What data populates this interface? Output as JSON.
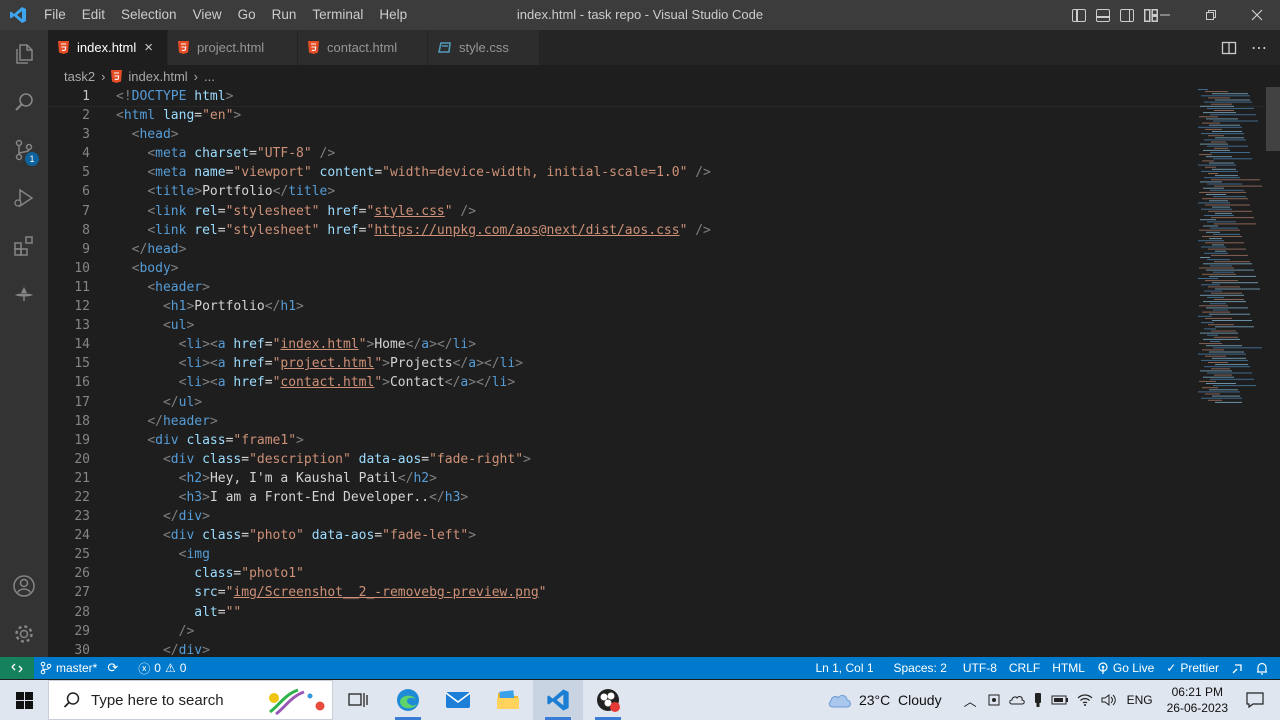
{
  "window": {
    "title": "index.html - task repo - Visual Studio Code"
  },
  "menu": [
    "File",
    "Edit",
    "Selection",
    "View",
    "Go",
    "Run",
    "Terminal",
    "Help"
  ],
  "tabs": [
    {
      "label": "index.html",
      "type": "html",
      "active": true
    },
    {
      "label": "project.html",
      "type": "html",
      "active": false
    },
    {
      "label": "contact.html",
      "type": "html",
      "active": false
    },
    {
      "label": "style.css",
      "type": "css",
      "active": false
    }
  ],
  "tab_close_glyph": "×",
  "breadcrumb": {
    "folder": "task2",
    "file": "index.html",
    "more": "..."
  },
  "activity_badge": "1",
  "editor": {
    "current_line": 1,
    "lines": [
      [
        [
          "br",
          "<!"
        ],
        [
          "tag",
          "DOCTYPE"
        ],
        [
          "txt",
          " "
        ],
        [
          "attr",
          "html"
        ],
        [
          "br",
          ">"
        ]
      ],
      [
        [
          "br",
          "<"
        ],
        [
          "tag",
          "html"
        ],
        [
          "txt",
          " "
        ],
        [
          "attr",
          "lang"
        ],
        [
          "txt",
          "="
        ],
        [
          "str",
          "\"en\""
        ],
        [
          "br",
          ">"
        ]
      ],
      [
        [
          "txt",
          "  "
        ],
        [
          "br",
          "<"
        ],
        [
          "tag",
          "head"
        ],
        [
          "br",
          ">"
        ]
      ],
      [
        [
          "txt",
          "    "
        ],
        [
          "br",
          "<"
        ],
        [
          "tag",
          "meta"
        ],
        [
          "txt",
          " "
        ],
        [
          "attr",
          "charset"
        ],
        [
          "txt",
          "="
        ],
        [
          "str",
          "\"UTF-8\""
        ],
        [
          "txt",
          " "
        ],
        [
          "br",
          "/>"
        ]
      ],
      [
        [
          "txt",
          "    "
        ],
        [
          "br",
          "<"
        ],
        [
          "tag",
          "meta"
        ],
        [
          "txt",
          " "
        ],
        [
          "attr",
          "name"
        ],
        [
          "txt",
          "="
        ],
        [
          "str",
          "\"viewport\""
        ],
        [
          "txt",
          " "
        ],
        [
          "attr",
          "content"
        ],
        [
          "txt",
          "="
        ],
        [
          "str",
          "\"width=device-width, initial-scale=1.0\""
        ],
        [
          "txt",
          " "
        ],
        [
          "br",
          "/>"
        ]
      ],
      [
        [
          "txt",
          "    "
        ],
        [
          "br",
          "<"
        ],
        [
          "tag",
          "title"
        ],
        [
          "br",
          ">"
        ],
        [
          "txt",
          "Portfolio"
        ],
        [
          "br",
          "</"
        ],
        [
          "tag",
          "title"
        ],
        [
          "br",
          ">"
        ]
      ],
      [
        [
          "txt",
          "    "
        ],
        [
          "br",
          "<"
        ],
        [
          "tag",
          "link"
        ],
        [
          "txt",
          " "
        ],
        [
          "attr",
          "rel"
        ],
        [
          "txt",
          "="
        ],
        [
          "str",
          "\"stylesheet\""
        ],
        [
          "txt",
          " "
        ],
        [
          "attr",
          "href"
        ],
        [
          "txt",
          "="
        ],
        [
          "str",
          "\""
        ],
        [
          "link",
          "style.css"
        ],
        [
          "str",
          "\""
        ],
        [
          "txt",
          " "
        ],
        [
          "br",
          "/>"
        ]
      ],
      [
        [
          "txt",
          "    "
        ],
        [
          "br",
          "<"
        ],
        [
          "tag",
          "link"
        ],
        [
          "txt",
          " "
        ],
        [
          "attr",
          "rel"
        ],
        [
          "txt",
          "="
        ],
        [
          "str",
          "\"stylesheet\""
        ],
        [
          "txt",
          " "
        ],
        [
          "attr",
          "href"
        ],
        [
          "txt",
          "="
        ],
        [
          "str",
          "\""
        ],
        [
          "link",
          "https://unpkg.com/aos@next/dist/aos.css"
        ],
        [
          "str",
          "\""
        ],
        [
          "txt",
          " "
        ],
        [
          "br",
          "/>"
        ]
      ],
      [
        [
          "txt",
          "  "
        ],
        [
          "br",
          "</"
        ],
        [
          "tag",
          "head"
        ],
        [
          "br",
          ">"
        ]
      ],
      [
        [
          "txt",
          "  "
        ],
        [
          "br",
          "<"
        ],
        [
          "tag",
          "body"
        ],
        [
          "br",
          ">"
        ]
      ],
      [
        [
          "txt",
          "    "
        ],
        [
          "br",
          "<"
        ],
        [
          "tag",
          "header"
        ],
        [
          "br",
          ">"
        ]
      ],
      [
        [
          "txt",
          "      "
        ],
        [
          "br",
          "<"
        ],
        [
          "tag",
          "h1"
        ],
        [
          "br",
          ">"
        ],
        [
          "txt",
          "Portfolio"
        ],
        [
          "br",
          "</"
        ],
        [
          "tag",
          "h1"
        ],
        [
          "br",
          ">"
        ]
      ],
      [
        [
          "txt",
          "      "
        ],
        [
          "br",
          "<"
        ],
        [
          "tag",
          "ul"
        ],
        [
          "br",
          ">"
        ]
      ],
      [
        [
          "txt",
          "        "
        ],
        [
          "br",
          "<"
        ],
        [
          "tag",
          "li"
        ],
        [
          "br",
          "><"
        ],
        [
          "tag",
          "a"
        ],
        [
          "txt",
          " "
        ],
        [
          "attr",
          "href"
        ],
        [
          "txt",
          "="
        ],
        [
          "str",
          "\""
        ],
        [
          "link",
          "index.html"
        ],
        [
          "str",
          "\""
        ],
        [
          "br",
          ">"
        ],
        [
          "txt",
          "Home"
        ],
        [
          "br",
          "</"
        ],
        [
          "tag",
          "a"
        ],
        [
          "br",
          "></"
        ],
        [
          "tag",
          "li"
        ],
        [
          "br",
          ">"
        ]
      ],
      [
        [
          "txt",
          "        "
        ],
        [
          "br",
          "<"
        ],
        [
          "tag",
          "li"
        ],
        [
          "br",
          "><"
        ],
        [
          "tag",
          "a"
        ],
        [
          "txt",
          " "
        ],
        [
          "attr",
          "href"
        ],
        [
          "txt",
          "="
        ],
        [
          "str",
          "\""
        ],
        [
          "link",
          "project.html"
        ],
        [
          "str",
          "\""
        ],
        [
          "br",
          ">"
        ],
        [
          "txt",
          "Projects"
        ],
        [
          "br",
          "</"
        ],
        [
          "tag",
          "a"
        ],
        [
          "br",
          "></"
        ],
        [
          "tag",
          "li"
        ],
        [
          "br",
          ">"
        ]
      ],
      [
        [
          "txt",
          "        "
        ],
        [
          "br",
          "<"
        ],
        [
          "tag",
          "li"
        ],
        [
          "br",
          "><"
        ],
        [
          "tag",
          "a"
        ],
        [
          "txt",
          " "
        ],
        [
          "attr",
          "href"
        ],
        [
          "txt",
          "="
        ],
        [
          "str",
          "\""
        ],
        [
          "link",
          "contact.html"
        ],
        [
          "str",
          "\""
        ],
        [
          "br",
          ">"
        ],
        [
          "txt",
          "Contact"
        ],
        [
          "br",
          "</"
        ],
        [
          "tag",
          "a"
        ],
        [
          "br",
          "></"
        ],
        [
          "tag",
          "li"
        ],
        [
          "br",
          ">"
        ]
      ],
      [
        [
          "txt",
          "      "
        ],
        [
          "br",
          "</"
        ],
        [
          "tag",
          "ul"
        ],
        [
          "br",
          ">"
        ]
      ],
      [
        [
          "txt",
          "    "
        ],
        [
          "br",
          "</"
        ],
        [
          "tag",
          "header"
        ],
        [
          "br",
          ">"
        ]
      ],
      [
        [
          "txt",
          "    "
        ],
        [
          "br",
          "<"
        ],
        [
          "tag",
          "div"
        ],
        [
          "txt",
          " "
        ],
        [
          "attr",
          "class"
        ],
        [
          "txt",
          "="
        ],
        [
          "str",
          "\"frame1\""
        ],
        [
          "br",
          ">"
        ]
      ],
      [
        [
          "txt",
          "      "
        ],
        [
          "br",
          "<"
        ],
        [
          "tag",
          "div"
        ],
        [
          "txt",
          " "
        ],
        [
          "attr",
          "class"
        ],
        [
          "txt",
          "="
        ],
        [
          "str",
          "\"description\""
        ],
        [
          "txt",
          " "
        ],
        [
          "attr",
          "data-aos"
        ],
        [
          "txt",
          "="
        ],
        [
          "str",
          "\"fade-right\""
        ],
        [
          "br",
          ">"
        ]
      ],
      [
        [
          "txt",
          "        "
        ],
        [
          "br",
          "<"
        ],
        [
          "tag",
          "h2"
        ],
        [
          "br",
          ">"
        ],
        [
          "txt",
          "Hey, I'm a Kaushal Patil"
        ],
        [
          "br",
          "</"
        ],
        [
          "tag",
          "h2"
        ],
        [
          "br",
          ">"
        ]
      ],
      [
        [
          "txt",
          "        "
        ],
        [
          "br",
          "<"
        ],
        [
          "tag",
          "h3"
        ],
        [
          "br",
          ">"
        ],
        [
          "txt",
          "I am a Front-End Developer.."
        ],
        [
          "br",
          "</"
        ],
        [
          "tag",
          "h3"
        ],
        [
          "br",
          ">"
        ]
      ],
      [
        [
          "txt",
          "      "
        ],
        [
          "br",
          "</"
        ],
        [
          "tag",
          "div"
        ],
        [
          "br",
          ">"
        ]
      ],
      [
        [
          "txt",
          "      "
        ],
        [
          "br",
          "<"
        ],
        [
          "tag",
          "div"
        ],
        [
          "txt",
          " "
        ],
        [
          "attr",
          "class"
        ],
        [
          "txt",
          "="
        ],
        [
          "str",
          "\"photo\""
        ],
        [
          "txt",
          " "
        ],
        [
          "attr",
          "data-aos"
        ],
        [
          "txt",
          "="
        ],
        [
          "str",
          "\"fade-left\""
        ],
        [
          "br",
          ">"
        ]
      ],
      [
        [
          "txt",
          "        "
        ],
        [
          "br",
          "<"
        ],
        [
          "tag",
          "img"
        ]
      ],
      [
        [
          "txt",
          "          "
        ],
        [
          "attr",
          "class"
        ],
        [
          "txt",
          "="
        ],
        [
          "str",
          "\"photo1\""
        ]
      ],
      [
        [
          "txt",
          "          "
        ],
        [
          "attr",
          "src"
        ],
        [
          "txt",
          "="
        ],
        [
          "str",
          "\""
        ],
        [
          "link",
          "img/Screenshot__2_-removebg-preview.png"
        ],
        [
          "str",
          "\""
        ]
      ],
      [
        [
          "txt",
          "          "
        ],
        [
          "attr",
          "alt"
        ],
        [
          "txt",
          "="
        ],
        [
          "str",
          "\"\""
        ]
      ],
      [
        [
          "txt",
          "        "
        ],
        [
          "br",
          "/>"
        ]
      ],
      [
        [
          "txt",
          "      "
        ],
        [
          "br",
          "</"
        ],
        [
          "tag",
          "div"
        ],
        [
          "br",
          ">"
        ]
      ]
    ]
  },
  "status": {
    "branch": "master*",
    "errors": "0",
    "warnings": "0",
    "position": "Ln 1, Col 1",
    "spaces": "Spaces: 2",
    "encoding": "UTF-8",
    "eol": "CRLF",
    "language": "HTML",
    "golive": "Go Live",
    "prettier": "Prettier"
  },
  "taskbar": {
    "search_placeholder": "Type here to search",
    "weather": "23°C  Cloudy",
    "lang": "ENG",
    "time": "06:21 PM",
    "date": "26-06-2023"
  },
  "colors": {
    "accent": "#007acc",
    "remote": "#16825d",
    "html_icon": "#e44d26",
    "css_icon": "#519aba"
  }
}
